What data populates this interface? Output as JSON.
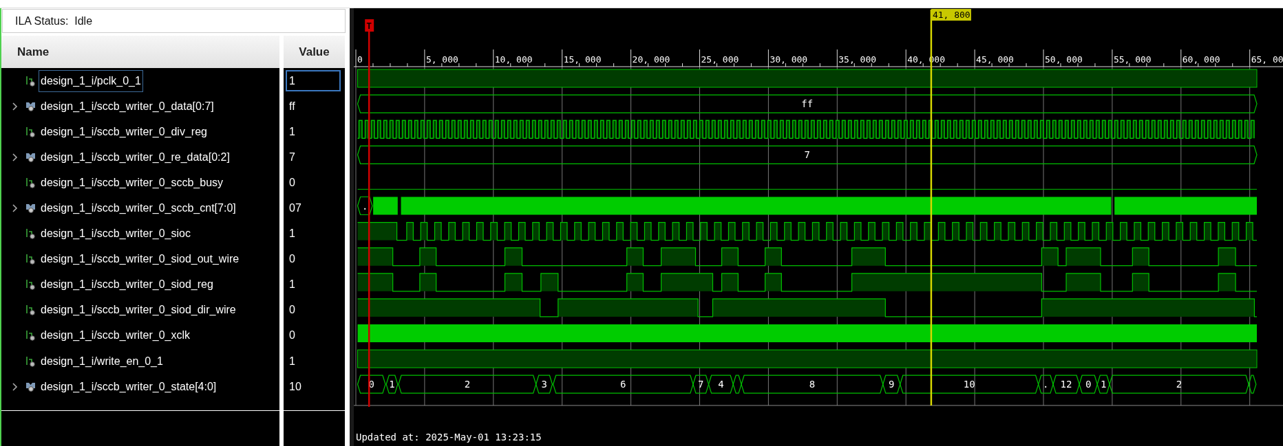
{
  "status": "ILA Status:  Idle",
  "columns": {
    "name": "Name",
    "value": "Value"
  },
  "trigger": {
    "label": "T"
  },
  "cursor": {
    "label": "41, 800"
  },
  "ruler": {
    "labels": [
      "0",
      "5, 000",
      "10, 000",
      "15, 000",
      "20, 000",
      "25, 000",
      "30, 000",
      "35, 000",
      "40, 000",
      "45, 000",
      "50, 000",
      "55, 000",
      "60, 000",
      "65, 00"
    ]
  },
  "rows": [
    {
      "kind": "bit",
      "name": "design_1_i/pclk_0_1",
      "value": "1",
      "selected": true
    },
    {
      "kind": "bus",
      "name": "design_1_i/sccb_writer_0_data[0:7]",
      "value": "ff",
      "selected": false,
      "expanded": false,
      "segments": [
        "ff"
      ]
    },
    {
      "kind": "bit",
      "name": "design_1_i/sccb_writer_0_div_reg",
      "value": "1",
      "selected": false
    },
    {
      "kind": "bus",
      "name": "design_1_i/sccb_writer_0_re_data[0:2]",
      "value": "7",
      "selected": false,
      "expanded": false,
      "segments": [
        "7"
      ]
    },
    {
      "kind": "bit",
      "name": "design_1_i/sccb_writer_0_sccb_busy",
      "value": "0",
      "selected": false
    },
    {
      "kind": "bus",
      "name": "design_1_i/sccb_writer_0_sccb_cnt[7:0]",
      "value": "07",
      "selected": false,
      "expanded": false,
      "segments": [
        "."
      ]
    },
    {
      "kind": "bit",
      "name": "design_1_i/sccb_writer_0_sioc",
      "value": "1",
      "selected": false
    },
    {
      "kind": "bit",
      "name": "design_1_i/sccb_writer_0_siod_out_wire",
      "value": "0",
      "selected": false
    },
    {
      "kind": "bit",
      "name": "design_1_i/sccb_writer_0_siod_reg",
      "value": "1",
      "selected": false
    },
    {
      "kind": "bit",
      "name": "design_1_i/sccb_writer_0_siod_dir_wire",
      "value": "0",
      "selected": false
    },
    {
      "kind": "bit",
      "name": "design_1_i/sccb_writer_0_xclk",
      "value": "0",
      "selected": false
    },
    {
      "kind": "bit",
      "name": "design_1_i/write_en_0_1",
      "value": "1",
      "selected": false
    },
    {
      "kind": "bus",
      "name": "design_1_i/sccb_writer_0_state[4:0]",
      "value": "10",
      "selected": false,
      "expanded": false,
      "segments": [
        "0",
        "1",
        "2",
        "3",
        "6",
        "7",
        "4",
        "8",
        "9",
        "10",
        ".",
        "12",
        "0",
        "1",
        "2"
      ]
    }
  ],
  "updated": "Updated at: 2025-May-01 13:23:15"
}
